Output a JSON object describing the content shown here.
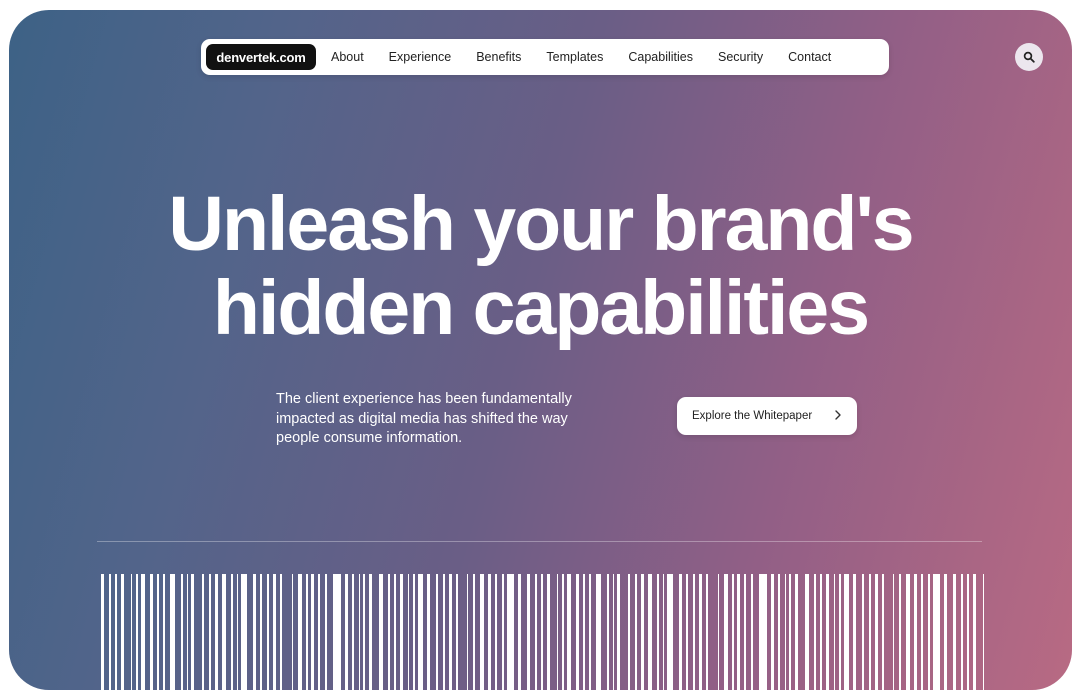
{
  "header": {
    "brand": "denvertek.com",
    "nav_items": [
      {
        "key": "about",
        "label": "About"
      },
      {
        "key": "experience",
        "label": "Experience"
      },
      {
        "key": "benefits",
        "label": "Benefits"
      },
      {
        "key": "templates",
        "label": "Templates"
      },
      {
        "key": "capabilities",
        "label": "Capabilities"
      },
      {
        "key": "security",
        "label": "Security"
      },
      {
        "key": "contact",
        "label": "Contact"
      }
    ],
    "search_icon": "search-icon"
  },
  "hero": {
    "headline_line1": "Unleash your brand's",
    "headline_line2": "hidden capabilities",
    "subtext_line1": "The client experience has been fundamentally",
    "subtext_line2": "impacted as digital media has shifted the way",
    "subtext_line3": "people consume information.",
    "cta_label": "Explore the Whitepaper",
    "cta_icon": "chevron-right-icon"
  },
  "colors": {
    "gradient_start": "#3d6286",
    "gradient_end": "#b86a83",
    "brand_bg": "#111111",
    "surface": "#ffffff"
  },
  "decor": {
    "barcode_icon": "barcode-graphic"
  }
}
